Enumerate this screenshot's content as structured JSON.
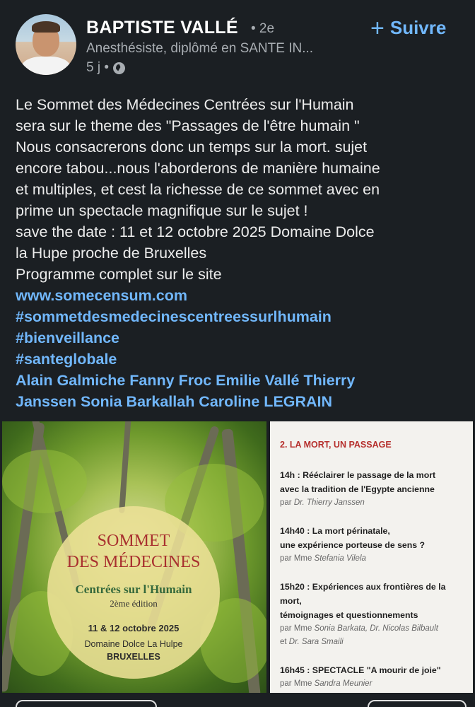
{
  "author": {
    "name": "BAPTISTE VALLÉ",
    "degree": "• 2e",
    "headline": "Anesthésiste, diplômé en SANTE IN...",
    "time": "5 j •",
    "follow_label": "Suivre"
  },
  "post": {
    "lines": [
      "Le Sommet des Médecines Centrées sur l'Humain",
      "sera sur le theme des \"Passages de l'être humain \"",
      "Nous consacrerons donc un temps sur la mort. sujet",
      "encore tabou...nous l'aborderons de manière humaine",
      "et multiples, et cest la richesse de ce sommet avec en",
      "prime un spectacle magnifique sur le sujet !",
      "save the date : 11 et 12 octobre 2025 Domaine Dolce",
      "la Hupe proche de Bruxelles",
      "Programme complet sur le site"
    ],
    "links": [
      "www.somecensum.com",
      "#sommetdesmedecinescentreessurlhumain",
      "#bienveillance",
      "#santeglobale"
    ],
    "mentions_line1": "Alain Galmiche Fanny Froc Emilie Vallé Thierry",
    "mentions_line2": "Janssen Sonia Barkallah Caroline LEGRAIN"
  },
  "poster": {
    "title1": "SOMMET",
    "title2": "DES MÉDECINES",
    "subtitle": "Centrées sur l'Humain",
    "edition": "2ème édition",
    "date": "11 & 12 octobre 2025",
    "venue": "Domaine Dolce La Hulpe",
    "city": "BRUXELLES"
  },
  "program": {
    "heading": "2. LA MORT, UN PASSAGE",
    "items": [
      {
        "title1": "14h : Rééclairer le passage de la mort",
        "title2": "avec la tradition de l'Egypte ancienne",
        "by": "par",
        "who": "Dr. Thierry Janssen"
      },
      {
        "title1": "14h40 : La mort périnatale,",
        "title2": "une expérience porteuse de sens ?",
        "by": "par Mme",
        "who": "Stefania Vilela"
      },
      {
        "title1": "15h20 : Expériences aux frontières de la",
        "title2": "mort,",
        "title3": "témoignages et questionnements",
        "by": "par Mme",
        "who": "Sonia Barkata, Dr. Nicolas Bilbault",
        "by2": "et",
        "who2": "Dr. Sara Smaili"
      },
      {
        "title1": "16h45 : SPECTACLE \"A mourir de joie\"",
        "by": "par Mme",
        "who": "Sandra Meunier"
      }
    ]
  }
}
